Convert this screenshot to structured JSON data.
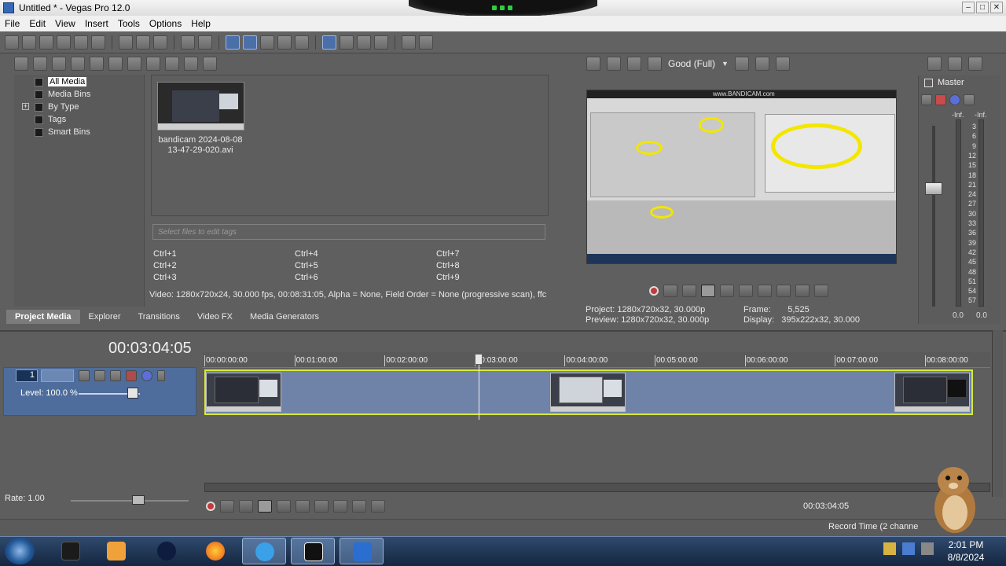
{
  "window": {
    "title": "Untitled * - Vegas Pro 12.0"
  },
  "menu": [
    "File",
    "Edit",
    "View",
    "Insert",
    "Tools",
    "Options",
    "Help"
  ],
  "project_media": {
    "tree": [
      {
        "label": "All Media",
        "icon": "all-media-icon",
        "selected": true
      },
      {
        "label": "Media Bins",
        "icon": "bin-icon"
      },
      {
        "label": "By Type",
        "icon": "bin-icon",
        "expandable": true
      },
      {
        "label": "Tags",
        "icon": "tag-icon"
      },
      {
        "label": "Smart Bins",
        "icon": "smart-bin-icon"
      }
    ],
    "media_item": {
      "name_line1": "bandicam 2024-08-08",
      "name_line2": "13-47-29-020.avi"
    },
    "tag_placeholder": "Select files to edit tags",
    "hotkeys": [
      "Ctrl+1",
      "Ctrl+2",
      "Ctrl+3",
      "Ctrl+4",
      "Ctrl+5",
      "Ctrl+6",
      "Ctrl+7",
      "Ctrl+8",
      "Ctrl+9"
    ],
    "info": "Video: 1280x720x24, 30.000 fps, 00:08:31:05, Alpha = None, Field Order = None (progressive scan), ffc"
  },
  "dock_tabs": [
    "Project Media",
    "Explorer",
    "Transitions",
    "Video FX",
    "Media Generators"
  ],
  "preview": {
    "quality": "Good (Full)",
    "overlay_text": "www.BANDICAM.com",
    "project_label": "Project:",
    "project_value": "1280x720x32, 30.000p",
    "preview_label": "Preview:",
    "preview_value": "1280x720x32, 30.000p",
    "frame_label": "Frame:",
    "frame_value": "5,525",
    "display_label": "Display:",
    "display_value": "395x222x32, 30.000"
  },
  "master": {
    "title": "Master",
    "inf_left": "-Inf.",
    "inf_right": "-Inf.",
    "scale": [
      "3",
      "6",
      "9",
      "12",
      "15",
      "18",
      "21",
      "24",
      "27",
      "30",
      "33",
      "36",
      "39",
      "42",
      "45",
      "48",
      "51",
      "54",
      "57"
    ],
    "value_left": "0.0",
    "value_right": "0.0"
  },
  "timeline": {
    "timecode": "00:03:04:05",
    "ruler": [
      "00:00:00:00",
      "00:01:00:00",
      "00:02:00:00",
      "00:03:00:00",
      "00:04:00:00",
      "00:05:00:00",
      "00:06:00:00",
      "00:07:00:00",
      "00:08:00:00"
    ],
    "track_number": "1",
    "level": "Level: 100.0 %",
    "rate": "Rate: 1.00",
    "cursor_time": "00:03:04:05",
    "record_time": "Record Time (2 channe"
  },
  "taskbar": {
    "time": "2:01 PM",
    "date": "8/8/2024",
    "apps": [
      "Windows Explorer",
      "Media Player",
      "Black Globe",
      "Firefox",
      "Internet Explorer",
      "7-Zip",
      "Vegas Pro"
    ]
  },
  "colors": {
    "accent": "#4b6fa8",
    "track": "#6f82a8",
    "selection_border": "#d7ea3a",
    "record": "#c23b3b"
  }
}
